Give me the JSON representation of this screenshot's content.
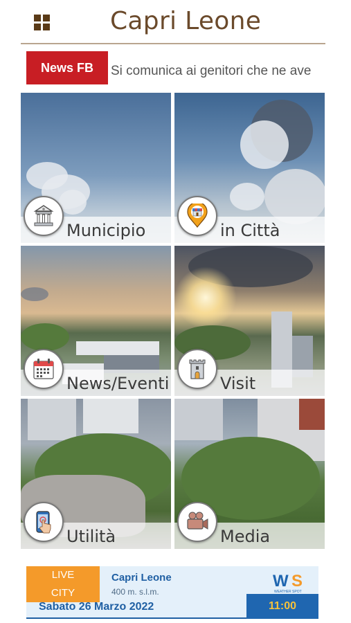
{
  "header": {
    "title": "Capri Leone",
    "menu_icon": "grid-menu-icon"
  },
  "ticker": {
    "label": "News FB",
    "text": "Si comunica ai genitori che ne ave"
  },
  "tiles": [
    {
      "label": "Municipio",
      "icon": "town-hall-icon"
    },
    {
      "label": "in Città",
      "icon": "shop-location-pin-icon"
    },
    {
      "label": "News/Eventi",
      "icon": "calendar-icon"
    },
    {
      "label": "Visit",
      "icon": "tower-icon"
    },
    {
      "label": "Utilità",
      "icon": "smartphone-touch-icon"
    },
    {
      "label": "Media",
      "icon": "video-camera-icon"
    }
  ],
  "footer": {
    "live_line1": "LIVE",
    "live_line2": "CITY",
    "place": "Capri Leone",
    "altitude": "400 m. s.l.m.",
    "date": "Sabato 26 Marzo 2022",
    "time": "11:00",
    "logo_w": "W",
    "logo_s": "S",
    "logo_tag": "WEATHER SPOT"
  },
  "colors": {
    "title": "#6b4a2b",
    "news_label_bg": "#c81e24",
    "live_bg": "#f49a2a",
    "footer_blue": "#1f66b0",
    "time_text": "#f7c23a"
  }
}
